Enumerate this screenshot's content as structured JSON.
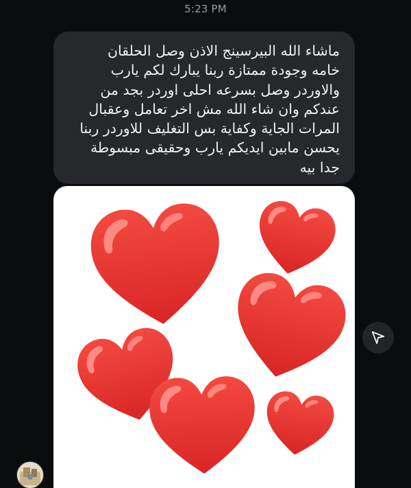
{
  "status": {
    "time": "5:23 PM"
  },
  "message": {
    "text": "ماشاء الله البيرسينج الاذن وصل الحلقان\nخامه وجودة ممتازة ربنا يبارك لكم يارب\nوالاوردر وصل بسرعه احلى اوردر بجد من\nعندكم وان شاء الله مش اخر تعامل وعقبال\nالمرات الجاية وكفاية بس التغليف للاوردر ربنا\nيحسن مابين ايديكم يارب وحقيقى مبسوطة\nجدا بيه"
  },
  "attachment": {
    "description": "red-hearts-sticker",
    "heart_color": "#e8302e",
    "highlight_color": "#ff8c86"
  },
  "actions": {
    "share_icon": "send-icon"
  },
  "sender": {
    "avatar_icon": "avatar"
  }
}
